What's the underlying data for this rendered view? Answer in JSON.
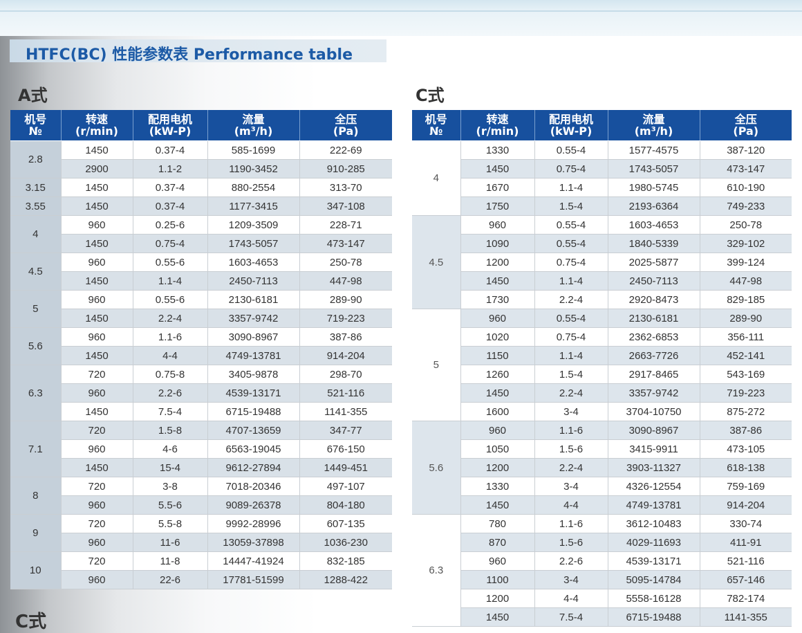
{
  "title": "HTFC(BC)  性能参数表  Performance table",
  "sectionA": "A式",
  "sectionC": "C式",
  "bottom_label": "C式",
  "headers": [
    {
      "line1": "机号",
      "line2": "№"
    },
    {
      "line1": "转速",
      "line2": "(r/min)"
    },
    {
      "line1": "配用电机",
      "line2": "(kW-P)"
    },
    {
      "line1": "流量",
      "line2": "(m³/h)"
    },
    {
      "line1": "全压",
      "line2": "(Pa)"
    }
  ],
  "tableA": [
    {
      "no": "2.8",
      "rows": [
        [
          "1450",
          "0.37-4",
          "585-1699",
          "222-69"
        ],
        [
          "2900",
          "1.1-2",
          "1190-3452",
          "910-285"
        ]
      ]
    },
    {
      "no": "3.15",
      "rows": [
        [
          "1450",
          "0.37-4",
          "880-2554",
          "313-70"
        ]
      ]
    },
    {
      "no": "3.55",
      "rows": [
        [
          "1450",
          "0.37-4",
          "1177-3415",
          "347-108"
        ]
      ]
    },
    {
      "no": "4",
      "rows": [
        [
          "960",
          "0.25-6",
          "1209-3509",
          "228-71"
        ],
        [
          "1450",
          "0.75-4",
          "1743-5057",
          "473-147"
        ]
      ]
    },
    {
      "no": "4.5",
      "rows": [
        [
          "960",
          "0.55-6",
          "1603-4653",
          "250-78"
        ],
        [
          "1450",
          "1.1-4",
          "2450-7113",
          "447-98"
        ]
      ]
    },
    {
      "no": "5",
      "rows": [
        [
          "960",
          "0.55-6",
          "2130-6181",
          "289-90"
        ],
        [
          "1450",
          "2.2-4",
          "3357-9742",
          "719-223"
        ]
      ]
    },
    {
      "no": "5.6",
      "rows": [
        [
          "960",
          "1.1-6",
          "3090-8967",
          "387-86"
        ],
        [
          "1450",
          "4-4",
          "4749-13781",
          "914-204"
        ]
      ]
    },
    {
      "no": "6.3",
      "rows": [
        [
          "720",
          "0.75-8",
          "3405-9878",
          "298-70"
        ],
        [
          "960",
          "2.2-6",
          "4539-13171",
          "521-116"
        ],
        [
          "1450",
          "7.5-4",
          "6715-19488",
          "1141-355"
        ]
      ]
    },
    {
      "no": "7.1",
      "rows": [
        [
          "720",
          "1.5-8",
          "4707-13659",
          "347-77"
        ],
        [
          "960",
          "4-6",
          "6563-19045",
          "676-150"
        ],
        [
          "1450",
          "15-4",
          "9612-27894",
          "1449-451"
        ]
      ]
    },
    {
      "no": "8",
      "rows": [
        [
          "720",
          "3-8",
          "7018-20346",
          "497-107"
        ],
        [
          "960",
          "5.5-6",
          "9089-26378",
          "804-180"
        ]
      ]
    },
    {
      "no": "9",
      "rows": [
        [
          "720",
          "5.5-8",
          "9992-28996",
          "607-135"
        ],
        [
          "960",
          "11-6",
          "13059-37898",
          "1036-230"
        ]
      ]
    },
    {
      "no": "10",
      "rows": [
        [
          "720",
          "11-8",
          "14447-41924",
          "832-185"
        ],
        [
          "960",
          "22-6",
          "17781-51599",
          "1288-422"
        ]
      ]
    }
  ],
  "tableC": [
    {
      "no": "4",
      "rows": [
        [
          "1330",
          "0.55-4",
          "1577-4575",
          "387-120"
        ],
        [
          "1450",
          "0.75-4",
          "1743-5057",
          "473-147"
        ],
        [
          "1670",
          "1.1-4",
          "1980-5745",
          "610-190"
        ],
        [
          "1750",
          "1.5-4",
          "2193-6364",
          "749-233"
        ]
      ]
    },
    {
      "no": "4.5",
      "rows": [
        [
          "960",
          "0.55-4",
          "1603-4653",
          "250-78"
        ],
        [
          "1090",
          "0.55-4",
          "1840-5339",
          "329-102"
        ],
        [
          "1200",
          "0.75-4",
          "2025-5877",
          "399-124"
        ],
        [
          "1450",
          "1.1-4",
          "2450-7113",
          "447-98"
        ],
        [
          "1730",
          "2.2-4",
          "2920-8473",
          "829-185"
        ]
      ]
    },
    {
      "no": "5",
      "rows": [
        [
          "960",
          "0.55-4",
          "2130-6181",
          "289-90"
        ],
        [
          "1020",
          "0.75-4",
          "2362-6853",
          "356-111"
        ],
        [
          "1150",
          "1.1-4",
          "2663-7726",
          "452-141"
        ],
        [
          "1260",
          "1.5-4",
          "2917-8465",
          "543-169"
        ],
        [
          "1450",
          "2.2-4",
          "3357-9742",
          "719-223"
        ],
        [
          "1600",
          "3-4",
          "3704-10750",
          "875-272"
        ]
      ]
    },
    {
      "no": "5.6",
      "rows": [
        [
          "960",
          "1.1-6",
          "3090-8967",
          "387-86"
        ],
        [
          "1050",
          "1.5-6",
          "3415-9911",
          "473-105"
        ],
        [
          "1200",
          "2.2-4",
          "3903-11327",
          "618-138"
        ],
        [
          "1330",
          "3-4",
          "4326-12554",
          "759-169"
        ],
        [
          "1450",
          "4-4",
          "4749-13781",
          "914-204"
        ]
      ]
    },
    {
      "no": "6.3",
      "rows": [
        [
          "780",
          "1.1-6",
          "3612-10483",
          "330-74"
        ],
        [
          "870",
          "1.5-6",
          "4029-11693",
          "411-91"
        ],
        [
          "960",
          "2.2-6",
          "4539-13171",
          "521-116"
        ],
        [
          "1100",
          "3-4",
          "5095-14784",
          "657-146"
        ],
        [
          "1200",
          "4-4",
          "5558-16128",
          "782-174"
        ],
        [
          "1450",
          "7.5-4",
          "6715-19488",
          "1141-355"
        ]
      ]
    }
  ]
}
